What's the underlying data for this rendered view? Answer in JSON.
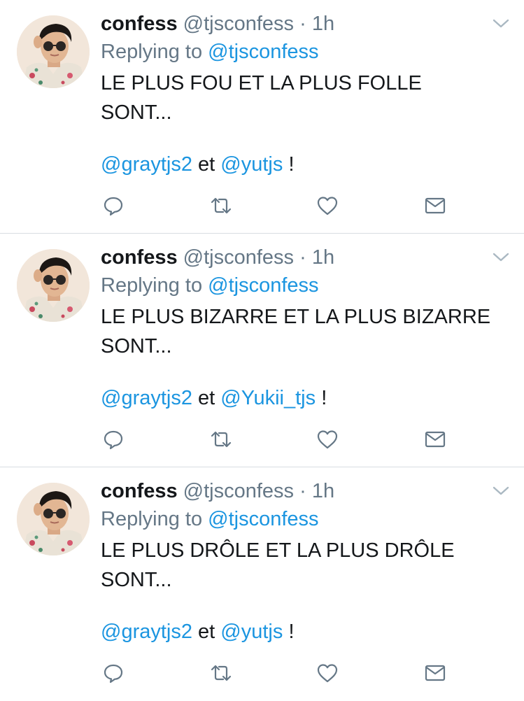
{
  "colors": {
    "text": "#14171a",
    "secondary": "#657786",
    "link": "#1b95e0",
    "divider": "#d8dde2"
  },
  "tweets": [
    {
      "name": "confess",
      "handle": "@tjsconfess",
      "separator": "·",
      "time": "1h",
      "replying_prefix": "Replying to",
      "replying_to": "@tjsconfess",
      "body": "LE PLUS FOU ET LA PLUS FOLLE\nSONT...",
      "mention_1": "@graytjs2",
      "connector": "et",
      "mention_2": "@yutjs",
      "suffix": "!"
    },
    {
      "name": "confess",
      "handle": "@tjsconfess",
      "separator": "·",
      "time": "1h",
      "replying_prefix": "Replying to",
      "replying_to": "@tjsconfess",
      "body": "LE PLUS BIZARRE ET LA PLUS BIZARRE\nSONT...",
      "mention_1": "@graytjs2",
      "connector": "et",
      "mention_2": "@Yukii_tjs",
      "suffix": "!"
    },
    {
      "name": "confess",
      "handle": "@tjsconfess",
      "separator": "·",
      "time": "1h",
      "replying_prefix": "Replying to",
      "replying_to": "@tjsconfess",
      "body": "LE PLUS DRÔLE ET LA PLUS DRÔLE\nSONT...",
      "mention_1": "@graytjs2",
      "connector": "et",
      "mention_2": "@yutjs",
      "suffix": "!"
    }
  ],
  "icons": {
    "reply": "reply-icon",
    "retweet": "retweet-icon",
    "like": "heart-icon",
    "message": "envelope-icon",
    "menu": "chevron-down-icon"
  }
}
